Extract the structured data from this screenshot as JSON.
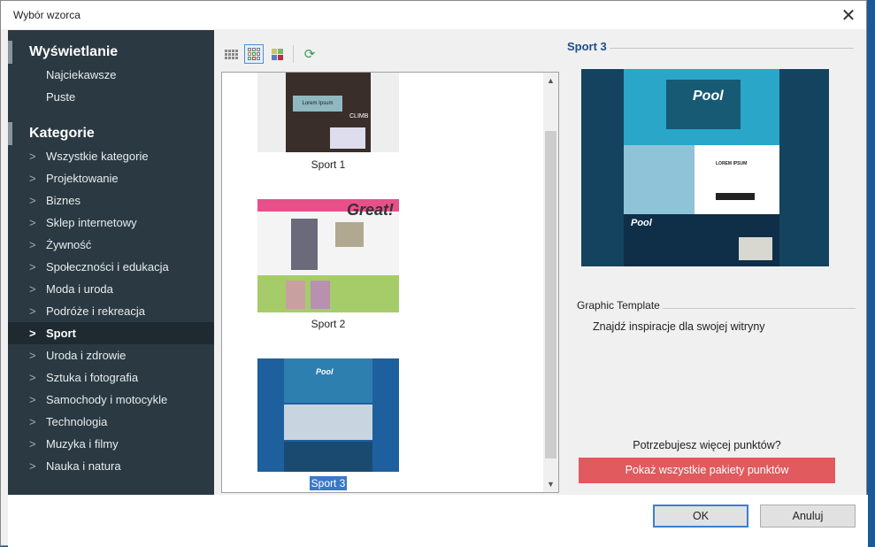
{
  "window": {
    "title": "Wybór wzorca"
  },
  "sidebar": {
    "display_heading": "Wyświetlanie",
    "display_items": [
      "Najciekawsze",
      "Puste"
    ],
    "categories_heading": "Kategorie",
    "categories": [
      "Wszystkie kategorie",
      "Projektowanie",
      "Biznes",
      "Sklep internetowy",
      "Żywność",
      "Społeczności i edukacja",
      "Moda i uroda",
      "Podróże i rekreacja",
      "Sport",
      "Uroda i zdrowie",
      "Sztuka i fotografia",
      "Samochody i motocykle",
      "Technologia",
      "Muzyka i filmy",
      "Nauka i natura"
    ],
    "selected": "Sport",
    "chevron": ">"
  },
  "toolbar": {
    "icons": [
      "small-grid-icon",
      "medium-grid-icon",
      "color-grid-icon",
      "refresh-icon"
    ],
    "active": "medium-grid-icon"
  },
  "templates": [
    {
      "label": "Sport 1",
      "thumb_text": "CLIMB",
      "thumb_sub": "Lorem Ipsum"
    },
    {
      "label": "Sport 2",
      "thumb_text": "Great!"
    },
    {
      "label": "Sport 3",
      "thumb_text": "Pool",
      "selected": true
    }
  ],
  "preview": {
    "title": "Sport 3",
    "logo": "Pool",
    "heading": "LOREM IPSUM",
    "type": "Graphic Template",
    "description": "Znajdź inspiracje dla swojej witryny"
  },
  "points": {
    "question": "Potrzebujesz więcej punktów?",
    "button": "Pokaż wszystkie pakiety punktów",
    "color": "#e05a5e"
  },
  "footer": {
    "ok": "OK",
    "cancel": "Anuluj"
  }
}
